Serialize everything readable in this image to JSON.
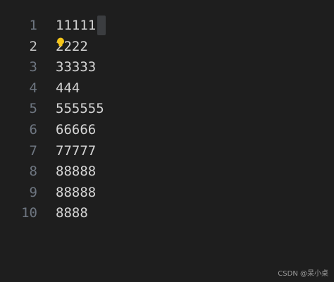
{
  "editor": {
    "active_line": 2,
    "lines": [
      {
        "number": "1",
        "text": "11111"
      },
      {
        "number": "2",
        "text": "2222"
      },
      {
        "number": "3",
        "text": "33333"
      },
      {
        "number": "4",
        "text": "444"
      },
      {
        "number": "5",
        "text": "555555"
      },
      {
        "number": "6",
        "text": "66666"
      },
      {
        "number": "7",
        "text": "77777"
      },
      {
        "number": "8",
        "text": "88888"
      },
      {
        "number": "9",
        "text": "88888"
      },
      {
        "number": "10",
        "text": "8888"
      }
    ]
  },
  "icons": {
    "lightbulb": "lightbulb-icon"
  },
  "colors": {
    "background": "#1e1e1e",
    "text": "#d4d4d4",
    "line_number": "#6e7681",
    "active_line_number": "#c6c6c6",
    "lightbulb": "#f5c518"
  },
  "watermark": "CSDN @呆小桌"
}
